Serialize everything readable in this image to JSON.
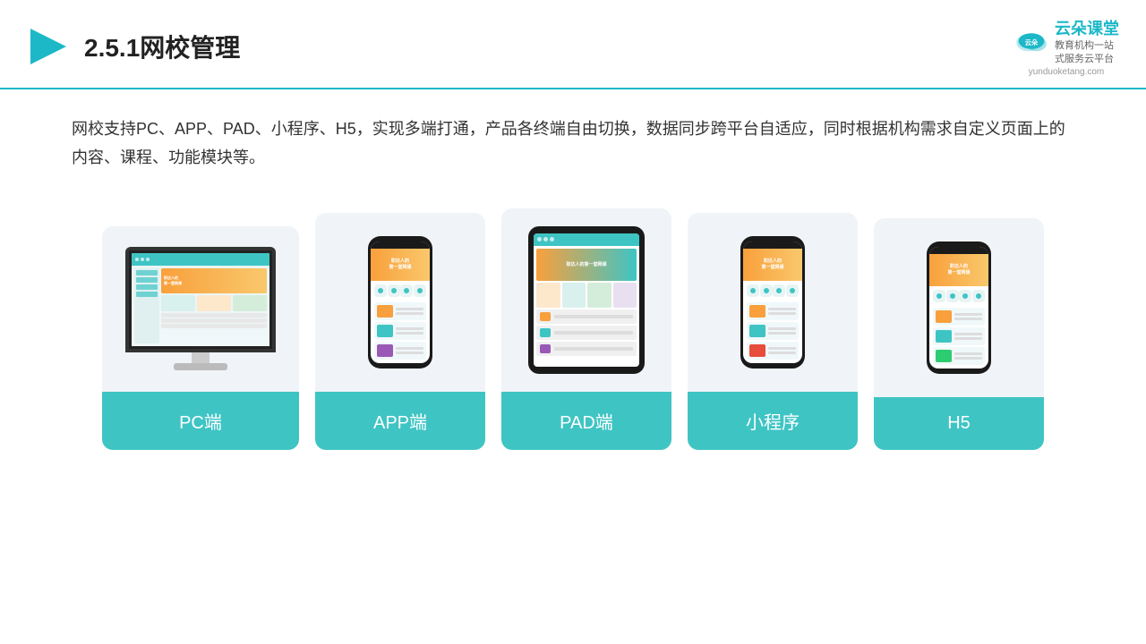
{
  "header": {
    "section_number": "2.5.1",
    "title": "网校管理",
    "logo_name": "云朵课堂",
    "logo_url": "yunduoketang.com",
    "logo_tagline": "教育机构一站\n式服务云平台"
  },
  "description": {
    "text": "网校支持PC、APP、PAD、小程序、H5，实现多端打通，产品各终端自由切换，数据同步跨平台自适应，同时根据机构需求自定义页面上的内容、课程、功能模块等。"
  },
  "cards": [
    {
      "id": "pc",
      "label": "PC端"
    },
    {
      "id": "app",
      "label": "APP端"
    },
    {
      "id": "pad",
      "label": "PAD端"
    },
    {
      "id": "mini",
      "label": "小程序"
    },
    {
      "id": "h5",
      "label": "H5"
    }
  ],
  "colors": {
    "accent": "#3fc4c4",
    "orange": "#f9a03c",
    "dark": "#222222",
    "card_bg": "#f0f4f8",
    "header_border": "#1cb8c8"
  }
}
